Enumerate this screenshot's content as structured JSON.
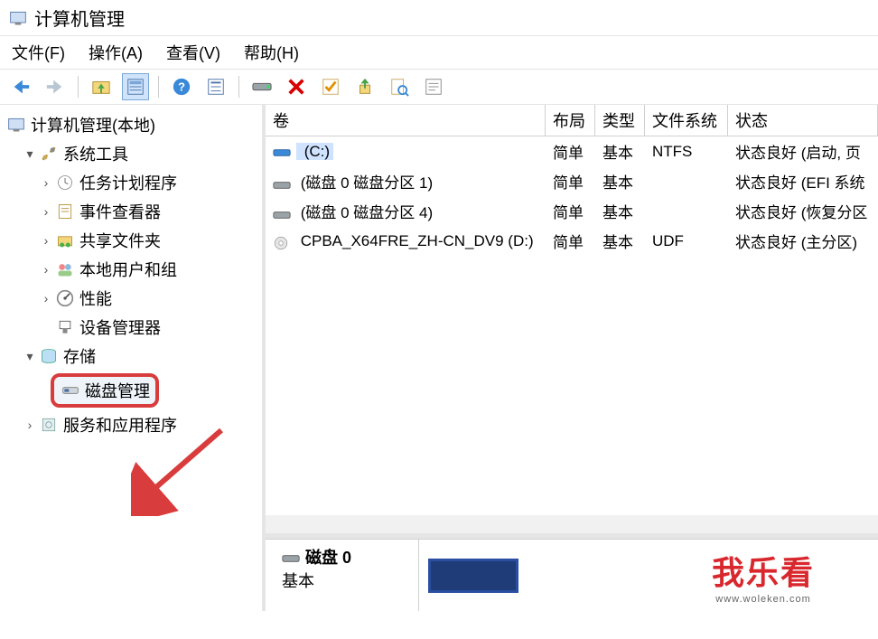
{
  "window": {
    "title": "计算机管理"
  },
  "menubar": {
    "file": "文件(F)",
    "action": "操作(A)",
    "view": "查看(V)",
    "help": "帮助(H)"
  },
  "tree": {
    "root": "计算机管理(本地)",
    "systools": {
      "label": "系统工具",
      "sched": "任务计划程序",
      "eventv": "事件查看器",
      "shared": "共享文件夹",
      "users": "本地用户和组",
      "perf": "性能",
      "devmgr": "设备管理器"
    },
    "storage": {
      "label": "存储",
      "diskmgmt": "磁盘管理"
    },
    "services": "服务和应用程序"
  },
  "list": {
    "headers": {
      "volume": "卷",
      "layout": "布局",
      "type": "类型",
      "fs": "文件系统",
      "status": "状态"
    },
    "rows": [
      {
        "label": " (C:)",
        "layout": "简单",
        "type": "基本",
        "fs": "NTFS",
        "status": "状态良好 (启动, 页",
        "selected": true,
        "kind": "hd"
      },
      {
        "label": " (磁盘 0 磁盘分区 1)",
        "layout": "简单",
        "type": "基本",
        "fs": "",
        "status": "状态良好 (EFI 系统",
        "selected": false,
        "kind": "hd"
      },
      {
        "label": " (磁盘 0 磁盘分区 4)",
        "layout": "简单",
        "type": "基本",
        "fs": "",
        "status": "状态良好 (恢复分区",
        "selected": false,
        "kind": "hd"
      },
      {
        "label": " CPBA_X64FRE_ZH-CN_DV9 (D:)",
        "layout": "简单",
        "type": "基本",
        "fs": "UDF",
        "status": "状态良好 (主分区)",
        "selected": false,
        "kind": "cd"
      }
    ]
  },
  "lower": {
    "diskname": "磁盘 0",
    "disktype": "基本"
  },
  "watermark": {
    "big": "我乐看",
    "small": "www.woleken.com"
  }
}
